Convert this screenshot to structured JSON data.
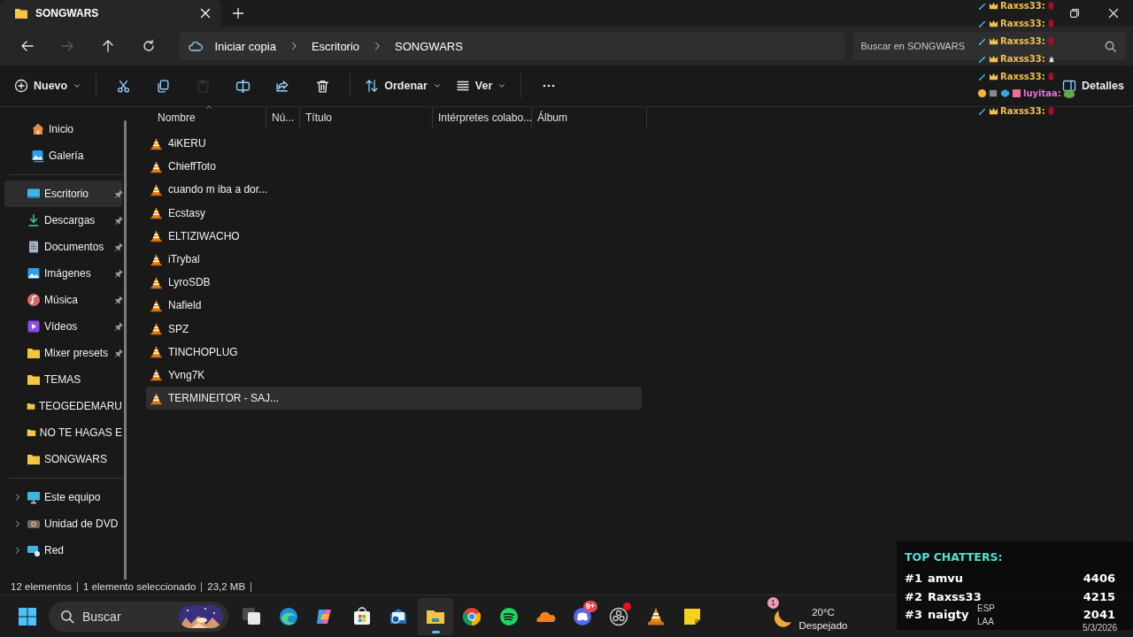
{
  "tab": {
    "title": "SONGWARS"
  },
  "nav": [
    {
      "kind": "back",
      "disabled": false
    },
    {
      "kind": "forward",
      "disabled": true
    },
    {
      "kind": "up",
      "disabled": false
    },
    {
      "kind": "refresh",
      "disabled": false
    }
  ],
  "address": {
    "segments": [
      "Iniciar copia",
      "Escritorio",
      "SONGWARS"
    ]
  },
  "search": {
    "placeholder": "Buscar en SONGWARS"
  },
  "commands": {
    "new": "Nuevo",
    "sort": "Ordenar",
    "view": "Ver",
    "details": "Detalles",
    "actions": [
      {
        "kind": "cut",
        "disabled": false
      },
      {
        "kind": "copy",
        "disabled": false
      },
      {
        "kind": "paste",
        "disabled": true
      },
      {
        "kind": "rename",
        "disabled": false
      },
      {
        "kind": "share",
        "disabled": false
      },
      {
        "kind": "delete",
        "disabled": false
      }
    ]
  },
  "sidebar": {
    "sections": [
      {
        "items": [
          {
            "label": "Inicio",
            "pinned": false,
            "selected": false
          },
          {
            "label": "Galería",
            "pinned": false,
            "selected": false
          }
        ]
      },
      {
        "items": [
          {
            "label": "Escritorio",
            "pinned": true,
            "selected": true
          },
          {
            "label": "Descargas",
            "pinned": true,
            "selected": false
          },
          {
            "label": "Documentos",
            "pinned": true,
            "selected": false
          },
          {
            "label": "Imágenes",
            "pinned": true,
            "selected": false
          },
          {
            "label": "Música",
            "pinned": true,
            "selected": false
          },
          {
            "label": "Vídeos",
            "pinned": true,
            "selected": false
          },
          {
            "label": "Mixer presets",
            "pinned": true,
            "selected": false
          },
          {
            "label": "TEMAS",
            "pinned": false,
            "selected": false
          },
          {
            "label": "TEOGEDEMARU",
            "pinned": false,
            "selected": false
          },
          {
            "label": "NO TE HAGAS E",
            "pinned": false,
            "selected": false
          },
          {
            "label": "SONGWARS",
            "pinned": false,
            "selected": false
          }
        ]
      },
      {
        "items": [
          {
            "label": "Este equipo",
            "pinned": false,
            "selected": false
          },
          {
            "label": "Unidad de DVD",
            "pinned": false,
            "selected": false
          },
          {
            "label": "Red",
            "pinned": false,
            "selected": false
          }
        ]
      }
    ]
  },
  "columns": [
    "Nombre",
    "Nú...",
    "Título",
    "Intérpretes colabo...",
    "Álbum"
  ],
  "files": [
    {
      "name": "4iKERU",
      "selected": false
    },
    {
      "name": "ChieffToto",
      "selected": false
    },
    {
      "name": "cuando m iba a dor...",
      "selected": false
    },
    {
      "name": "Ecstasy",
      "selected": false
    },
    {
      "name": "ELTIZIWACHO",
      "selected": false
    },
    {
      "name": "iTrybal",
      "selected": false
    },
    {
      "name": "LyroSDB",
      "selected": false
    },
    {
      "name": "Nafield",
      "selected": false
    },
    {
      "name": "SPZ",
      "selected": false
    },
    {
      "name": "TINCHOPLUG",
      "selected": false
    },
    {
      "name": "Yvng7K",
      "selected": false
    },
    {
      "name": "TERMINEITOR - SAJ...",
      "selected": true
    }
  ],
  "status": {
    "count": "12 elementos",
    "selection": "1 elemento seleccionado",
    "size": "23,2 MB"
  },
  "taskbar": {
    "search_placeholder": "Buscar",
    "apps": [
      {
        "kind": "taskview",
        "active": false,
        "notify": false
      },
      {
        "kind": "edge",
        "active": false,
        "notify": false
      },
      {
        "kind": "copilot",
        "active": false,
        "notify": false
      },
      {
        "kind": "store",
        "active": false,
        "notify": false
      },
      {
        "kind": "mail",
        "active": false,
        "notify": false
      },
      {
        "kind": "explorer",
        "active": true,
        "notify": false
      },
      {
        "kind": "chrome",
        "active": false,
        "notify": false
      },
      {
        "kind": "spotify",
        "active": false,
        "notify": false
      },
      {
        "kind": "cloud",
        "active": false,
        "notify": false
      },
      {
        "kind": "discord",
        "active": false,
        "notify": false,
        "badge": "9+"
      },
      {
        "kind": "obs",
        "active": false,
        "notify": true
      },
      {
        "kind": "vlc",
        "active": false,
        "notify": false
      },
      {
        "kind": "notes",
        "active": false,
        "notify": false
      }
    ],
    "weather": {
      "badge": "1",
      "temp": "20°C",
      "desc": "Despejado"
    },
    "language": [
      "ESP",
      "LAA"
    ],
    "date": "5/3/2026"
  },
  "chat": [
    {
      "user": "Raxss33:",
      "kind": "mod",
      "color": "#f2c14e"
    },
    {
      "user": "Raxss33:",
      "kind": "mod",
      "color": "#f2c14e"
    },
    {
      "user": "Raxss33:",
      "kind": "mod",
      "color": "#f2c14e"
    },
    {
      "user": "Raxss33:",
      "kind": "mod",
      "color": "#f2c14e"
    },
    {
      "user": "Raxss33:",
      "kind": "mod",
      "color": "#f2c14e"
    },
    {
      "user": "luyitaa:",
      "kind": "sub",
      "color": "#e86fd6"
    },
    {
      "user": "Raxss33:",
      "kind": "mod",
      "color": "#f2c14e"
    }
  ],
  "top_chatters": {
    "title": "TOP CHATTERS:",
    "rows": [
      {
        "rank": "#1",
        "name": "amvu",
        "score": "4406"
      },
      {
        "rank": "#2",
        "name": "Raxss33",
        "score": "4215"
      },
      {
        "rank": "#3",
        "name": "naigty",
        "score": "2041"
      }
    ]
  }
}
